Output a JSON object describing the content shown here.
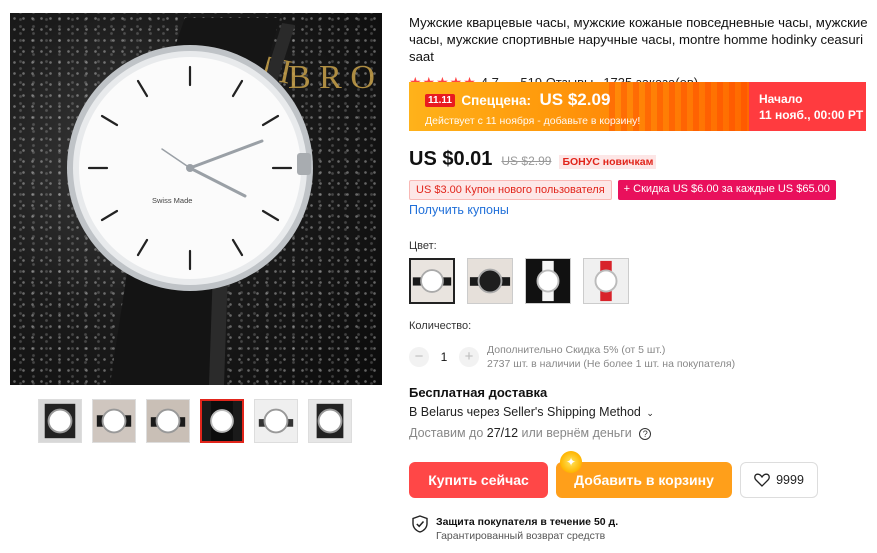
{
  "product": {
    "title": "Мужские кварцевые часы, мужские кожаные повседневные часы, мужские часы, мужские спортивные наручные часы, montre homme hodinky ceasuri saat",
    "dial_text": "Swiss Made",
    "rating": "4.7",
    "reviews": "519 Отзывы",
    "orders": "1735 заказа(ов)",
    "stars": "★★★★★"
  },
  "promo": {
    "badge": "11.11",
    "label": "Спеццена:",
    "price": "US $2.09",
    "note": "Действует с 11 ноября - добавьте в корзину!",
    "start_label": "Начало",
    "start_time": "11 нояб., 00:00 PT"
  },
  "pricing": {
    "price": "US $0.01",
    "old_price": "US $2.99",
    "bonus": "БОНУС новичкам"
  },
  "coupons": {
    "c1": "US $3.00 Купон нового пользователя",
    "c2": "+ Скидка US $6.00 за каждые US $65.00",
    "link": "Получить купоны"
  },
  "color": {
    "label": "Цвет:",
    "swatches": [
      "white-dial-black-strap",
      "black-dial-black-strap",
      "white-dial-white-strap",
      "white-dial-red-strap"
    ]
  },
  "quantity": {
    "label": "Количество:",
    "value": "1",
    "discount": "Дополнительно Скидка 5% (от 5 шт.)",
    "stock": "2737 шт. в наличии (Не более 1 шт. на покупателя)"
  },
  "shipping": {
    "title": "Бесплатная доставка",
    "method": "В Belarus через Seller's Shipping Method",
    "date_prefix": "Доставим до",
    "date": "27/12",
    "date_suffix": "или вернём деньги"
  },
  "actions": {
    "buy": "Купить сейчас",
    "cart": "Добавить в корзину",
    "wishlist_count": "9999"
  },
  "protection": {
    "title": "Защита покупателя в течение 50 д.",
    "subtitle": "Гарантированный возврат средств"
  },
  "colors": {
    "accent_red": "#ff4747",
    "accent_orange": "#ff9f1a",
    "link_blue": "#2170d9",
    "coupon_pink": "#e9105c"
  }
}
